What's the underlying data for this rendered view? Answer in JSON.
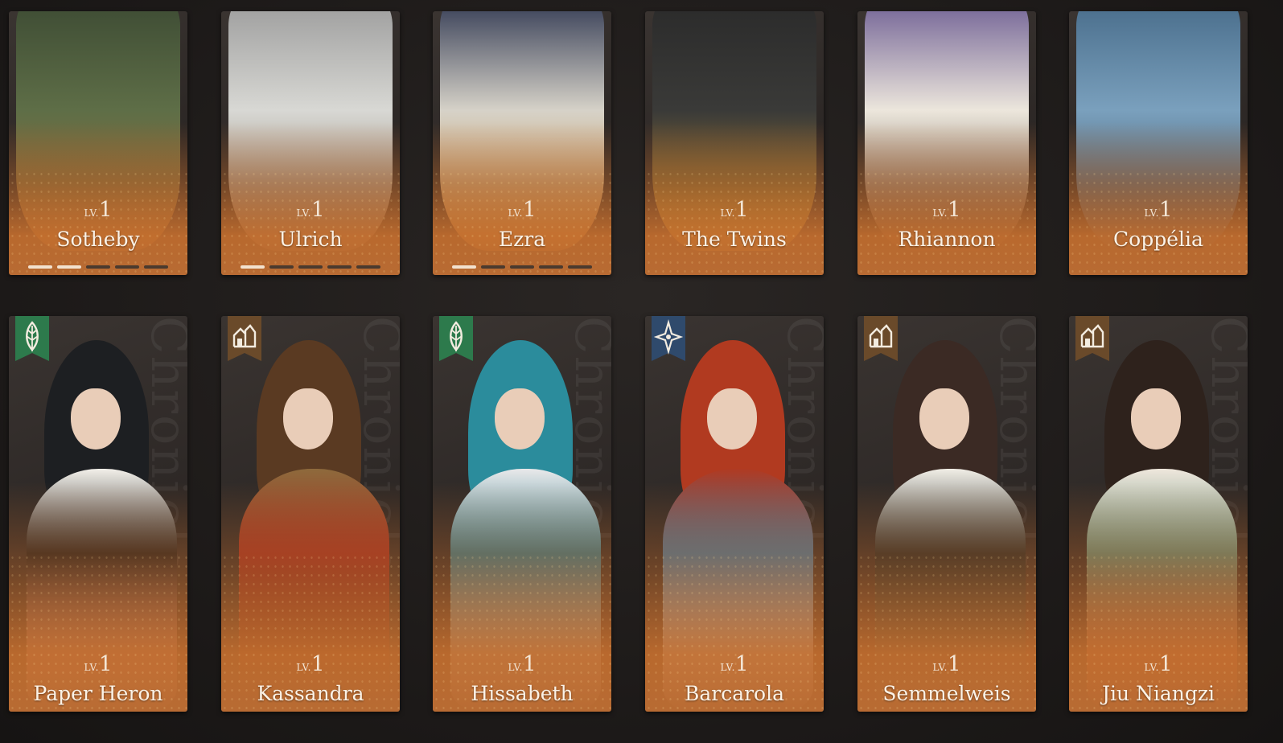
{
  "level_prefix": "LV.",
  "row1": [
    {
      "name": "Sotheby",
      "level": "1",
      "pips_on": 2,
      "pips_total": 5,
      "palette": [
        "#3c4a33",
        "#5e6e47",
        "#a36a32"
      ],
      "bg_text": ""
    },
    {
      "name": "Ulrich",
      "level": "1",
      "pips_on": 1,
      "pips_total": 5,
      "palette": [
        "#9a9a9a",
        "#d8d8d4",
        "#7a6a55"
      ],
      "bg_text": ""
    },
    {
      "name": "Ezra",
      "level": "1",
      "pips_on": 1,
      "pips_total": 5,
      "palette": [
        "#2e3650",
        "#d6d2c8",
        "#c68a3c"
      ],
      "bg_text": ""
    },
    {
      "name": "The Twins",
      "level": "1",
      "pips_on": 0,
      "pips_total": 0,
      "palette": [
        "#2a2a2a",
        "#3a3a38",
        "#c09230"
      ],
      "bg_text": ""
    },
    {
      "name": "Rhiannon",
      "level": "1",
      "pips_on": 0,
      "pips_total": 0,
      "palette": [
        "#6c5c92",
        "#ece6dc",
        "#4a3a2c"
      ],
      "bg_text": ""
    },
    {
      "name": "Coppélia",
      "level": "1",
      "pips_on": 0,
      "pips_total": 0,
      "palette": [
        "#466a88",
        "#7aa0bd",
        "#2f3f4c"
      ],
      "bg_text": ""
    }
  ],
  "row2": [
    {
      "name": "Paper Heron",
      "level": "1",
      "badge": "leaf-icon",
      "badge_color": "#2d7a4c",
      "palette": [
        "#1a1a1a",
        "#e7a8a6",
        "#f2efe9"
      ],
      "hair": "#1d1f22",
      "bg_text": "Chronicle"
    },
    {
      "name": "Kassandra",
      "level": "1",
      "badge": "ruins-icon",
      "badge_color": "#6a4a2a",
      "palette": [
        "#a32a1e",
        "#3b2a1e",
        "#8e6a3c"
      ],
      "hair": "#5a3a22",
      "bg_text": "Chronicle"
    },
    {
      "name": "Hissabeth",
      "level": "1",
      "badge": "leaf-icon",
      "badge_color": "#2d7a4c",
      "palette": [
        "#2e7a8c",
        "#c9d0d6",
        "#e9e9ea"
      ],
      "hair": "#2b8c9c",
      "bg_text": "Chronicle"
    },
    {
      "name": "Barcarola",
      "level": "1",
      "badge": "star-icon",
      "badge_color": "#2f4a6c",
      "palette": [
        "#3e78a0",
        "#e8e8e8",
        "#b03a22"
      ],
      "hair": "#b13a20",
      "bg_text": "Chronicle"
    },
    {
      "name": "Semmelweis",
      "level": "1",
      "badge": "ruins-icon",
      "badge_color": "#6a4a2a",
      "palette": [
        "#1c2424",
        "#2e4a44",
        "#f1eee6"
      ],
      "hair": "#3b2a24",
      "bg_text": "Chronicle"
    },
    {
      "name": "Jiu Niangzi",
      "level": "1",
      "badge": "ruins-icon",
      "badge_color": "#6a4a2a",
      "palette": [
        "#5e8c78",
        "#c2452a",
        "#efe7dc"
      ],
      "hair": "#2e221c",
      "bg_text": "Chronicle"
    }
  ]
}
